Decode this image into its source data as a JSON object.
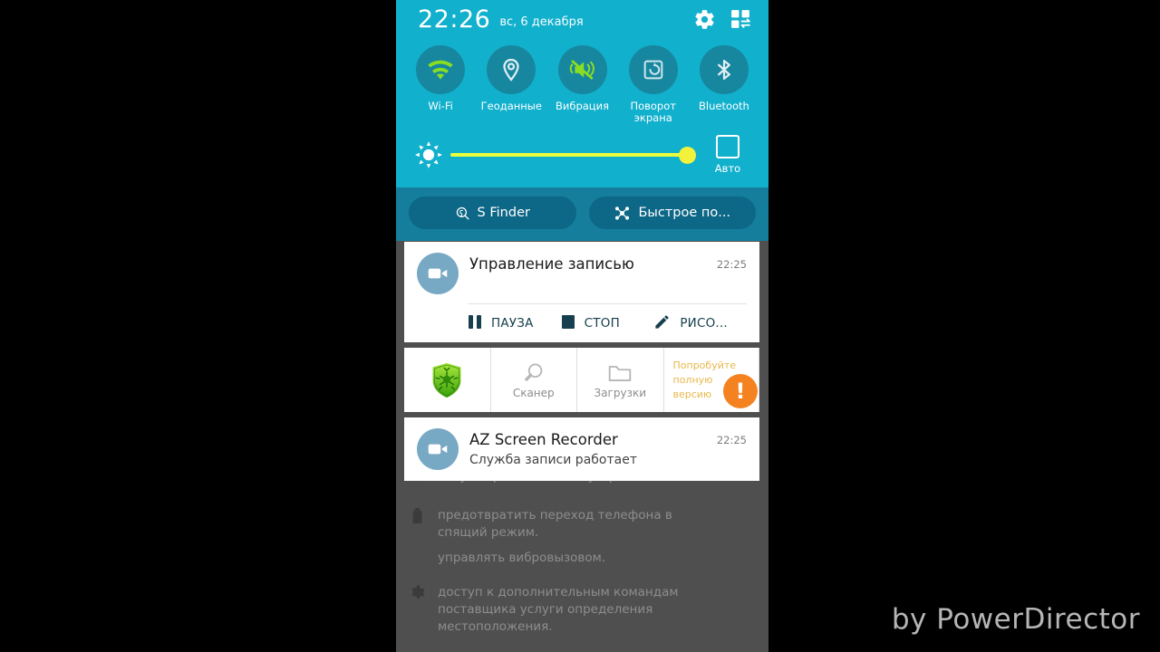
{
  "status_bar": {
    "time": "22:26",
    "date": "вс, 6 декабря",
    "settings_icon": "gear-icon",
    "edit_icon": "grid-edit-icon"
  },
  "quick_toggles": [
    {
      "label": "Wi-Fi",
      "icon": "wifi-icon",
      "active": true
    },
    {
      "label": "Геоданные",
      "icon": "location-pin-icon",
      "active": false
    },
    {
      "label": "Вибрация",
      "icon": "vibrate-mute-icon",
      "active": true
    },
    {
      "label": "Поворот\nэкрана",
      "label_line1": "Поворот",
      "label_line2": "экрана",
      "icon": "screen-rotation-icon",
      "active": false
    },
    {
      "label": "Bluetooth",
      "icon": "bluetooth-icon",
      "active": false
    }
  ],
  "brightness": {
    "icon": "brightness-sun-icon",
    "value": 100,
    "auto_label": "Авто",
    "auto_checked": false
  },
  "shortcuts": [
    {
      "label": "S Finder",
      "icon": "s-finder-icon"
    },
    {
      "label": "Быстрое по...",
      "icon": "quick-connect-icon"
    }
  ],
  "notifications": [
    {
      "id": "recording-control",
      "app_icon": "video-camera-icon",
      "title": "Управление записью",
      "time": "22:25",
      "actions": [
        {
          "label": "ПАУЗА",
          "icon": "pause-icon"
        },
        {
          "label": "СТОП",
          "icon": "stop-icon"
        },
        {
          "label": "РИСО...",
          "icon": "pencil-icon"
        }
      ]
    },
    {
      "id": "az-screen-recorder",
      "app_icon": "video-camera-icon",
      "title": "AZ Screen Recorder",
      "subtitle": "Служба записи работает",
      "time": "22:25"
    }
  ],
  "drweb": {
    "shield_icon": "drweb-shield-icon",
    "cells": [
      {
        "label": "",
        "icon": "drweb-shield-icon"
      },
      {
        "label": "Сканер",
        "icon": "magnifier-icon"
      },
      {
        "label": "Загрузки",
        "icon": "folder-icon"
      }
    ],
    "promo_line1": "Попробуйте",
    "promo_line2": "полную",
    "promo_line3": "версию",
    "badge": "!"
  },
  "background_app": {
    "rows": [
      {
        "icon": "chart-icon",
        "text": "запуск при включении устройства"
      },
      {
        "icon": "battery-icon",
        "text": "предотвратить переход телефона в спящий режим.\nуправлять вибровызовом."
      },
      {
        "icon": "gear-icon",
        "text": "доступ к дополнительным командам поставщика услуги определения местоположения."
      }
    ],
    "row2_line1": "предотвратить переход телефона в",
    "row2_line2": "спящий режим.",
    "row2_line3": "управлять вибровызовом.",
    "row3_line1": "доступ к дополнительным командам",
    "row3_line2": "поставщика услуги определения",
    "row3_line3": "местоположения."
  },
  "watermark": {
    "text": "by PowerDirector"
  },
  "colors": {
    "panel_cyan": "#11b0cd",
    "toggle_circle": "#17879f",
    "active_green": "#8ade22",
    "shortcut_row": "#147e9c",
    "pill": "#0d6786",
    "slider_yellow": "#eaff3d",
    "badge_orange": "#f58220",
    "action_text": "#16404d"
  }
}
